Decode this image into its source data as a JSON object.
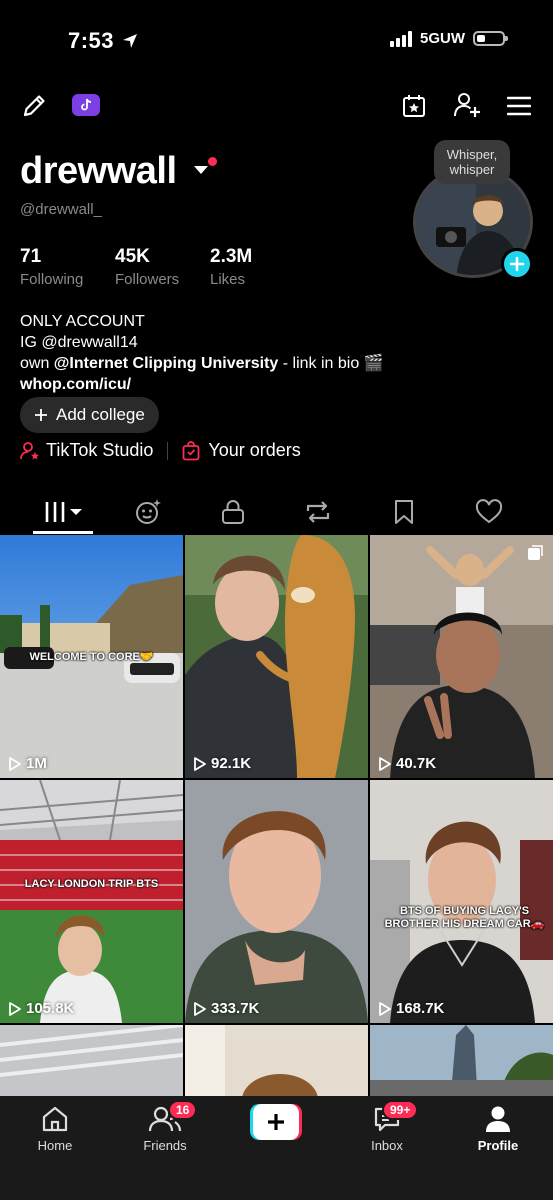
{
  "status": {
    "time": "7:53",
    "network": "5GUW"
  },
  "profile": {
    "username": "drewwall",
    "handle": "@drewwall_",
    "whisper": "Whisper, whisper",
    "stats": [
      {
        "value": "71",
        "label": "Following"
      },
      {
        "value": "45K",
        "label": "Followers"
      },
      {
        "value": "2.3M",
        "label": "Likes"
      }
    ],
    "bio": {
      "line1": "ONLY ACCOUNT",
      "line2": "IG @drewwall14",
      "line3_prefix": "own ",
      "line3_bold": "@Internet Clipping University",
      "line3_suffix": " - link in bio 🎬",
      "link": "whop.com/icu/"
    },
    "add_college": "Add college",
    "studio": "TikTok Studio",
    "orders": "Your orders"
  },
  "videos": [
    {
      "views": "1M",
      "caption": "WELCOME TO CORE🤝"
    },
    {
      "views": "92.1K",
      "caption": ""
    },
    {
      "views": "40.7K",
      "caption": ""
    },
    {
      "views": "105.8K",
      "caption": "LACY LONDON TRIP BTS"
    },
    {
      "views": "333.7K",
      "caption": ""
    },
    {
      "views": "168.7K",
      "caption": "BTS OF BUYING LACY'S BROTHER HIS DREAM CAR🚗"
    }
  ],
  "nav": {
    "home": "Home",
    "friends": "Friends",
    "friends_badge": "16",
    "inbox": "Inbox",
    "inbox_badge": "99+",
    "profile": "Profile"
  },
  "colors": {
    "accent": "#fe2c55",
    "cyan": "#20d5ec",
    "purple": "#7b3fe4"
  }
}
